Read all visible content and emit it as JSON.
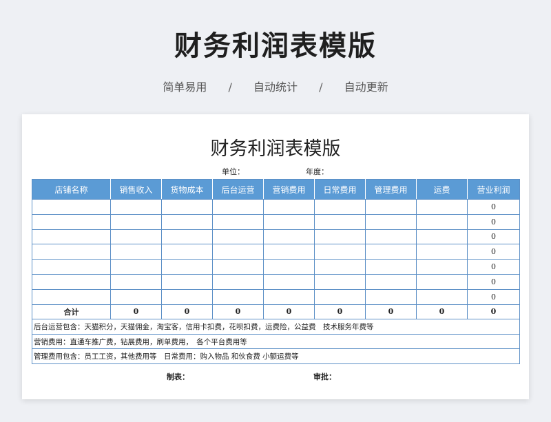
{
  "page": {
    "title": "财务利润表模版",
    "tagline": [
      "简单易用",
      "自动统计",
      "自动更新"
    ],
    "separator": "/"
  },
  "sheet": {
    "title": "财务利润表模版",
    "unit_label": "单位：",
    "year_label": "年度：",
    "columns": [
      "店铺名称",
      "销售收入",
      "货物成本",
      "后台运营",
      "营销费用",
      "日常费用",
      "管理费用",
      "运费",
      "营业利润"
    ],
    "rows": [
      [
        "",
        "",
        "",
        "",
        "",
        "",
        "",
        "",
        "0"
      ],
      [
        "",
        "",
        "",
        "",
        "",
        "",
        "",
        "",
        "0"
      ],
      [
        "",
        "",
        "",
        "",
        "",
        "",
        "",
        "",
        "0"
      ],
      [
        "",
        "",
        "",
        "",
        "",
        "",
        "",
        "",
        "0"
      ],
      [
        "",
        "",
        "",
        "",
        "",
        "",
        "",
        "",
        "0"
      ],
      [
        "",
        "",
        "",
        "",
        "",
        "",
        "",
        "",
        "0"
      ],
      [
        "",
        "",
        "",
        "",
        "",
        "",
        "",
        "",
        "0"
      ]
    ],
    "total": [
      "合计",
      "0",
      "0",
      "0",
      "0",
      "0",
      "0",
      "0",
      "0"
    ],
    "notes": [
      "后台运营包含：天猫积分，天猫佣金，淘宝客，信用卡扣费，花呗扣费，运费险，公益费　技术服务年费等",
      "营销费用：直通车推广费，钻展费用，刷单费用，　各个平台费用等",
      "管理费用包含：员工工资，其他费用等　日常费用：购入物品  和伙食费  小额运费等"
    ],
    "footer": {
      "maker_label": "制表：",
      "approver_label": "审批："
    }
  },
  "colors": {
    "header_bg": "#5b9bd5",
    "border": "#5b8fc6",
    "page_bg": "#eef0f4"
  }
}
